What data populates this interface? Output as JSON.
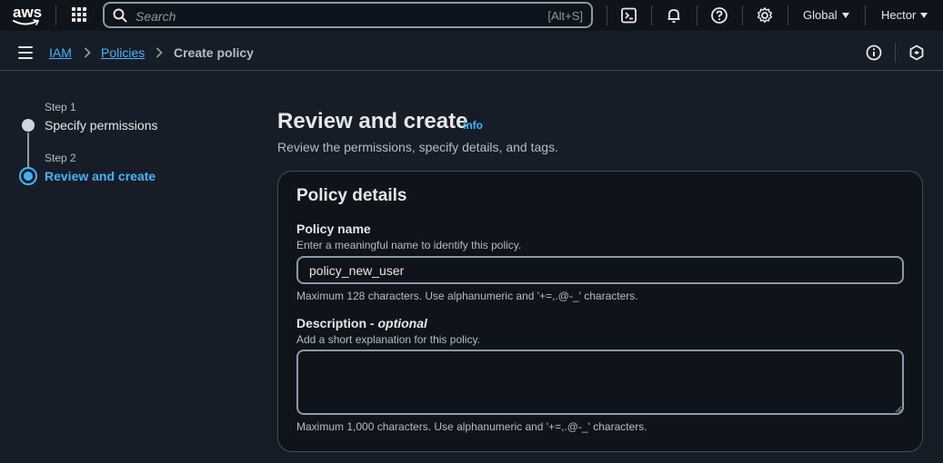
{
  "topnav": {
    "logo_text": "aws",
    "search": {
      "placeholder": "Search",
      "shortcut": "[Alt+S]"
    },
    "region": "Global",
    "user": "Hector",
    "icons": [
      "services-grid-icon",
      "search-icon",
      "cloudshell-icon",
      "bell-icon",
      "help-icon",
      "gear-icon"
    ]
  },
  "breadcrumb": {
    "items": [
      {
        "label": "IAM",
        "link": true
      },
      {
        "label": "Policies",
        "link": true
      },
      {
        "label": "Create policy",
        "link": false
      }
    ]
  },
  "wizard": {
    "steps": [
      {
        "step_label": "Step 1",
        "title": "Specify permissions",
        "state": "completed"
      },
      {
        "step_label": "Step 2",
        "title": "Review and create",
        "state": "current"
      }
    ]
  },
  "main": {
    "title": "Review and create",
    "info_label": "Info",
    "description": "Review the permissions, specify details, and tags."
  },
  "policy_details": {
    "title": "Policy details",
    "name": {
      "label": "Policy name",
      "hint": "Enter a meaningful name to identify this policy.",
      "value": "policy_new_user",
      "constraint": "Maximum 128 characters. Use alphanumeric and '+=,.@-_' characters."
    },
    "description": {
      "label": "Description - ",
      "label_optional": "optional",
      "hint": "Add a short explanation for this policy.",
      "value": "",
      "constraint": "Maximum 1,000 characters. Use alphanumeric and '+=,.@-_' characters."
    }
  },
  "colors": {
    "nav_bg": "#0f141a",
    "page_bg": "#161d26",
    "accent": "#42b4ff",
    "text": "#e5e7eb",
    "muted": "#b4bcc7"
  }
}
